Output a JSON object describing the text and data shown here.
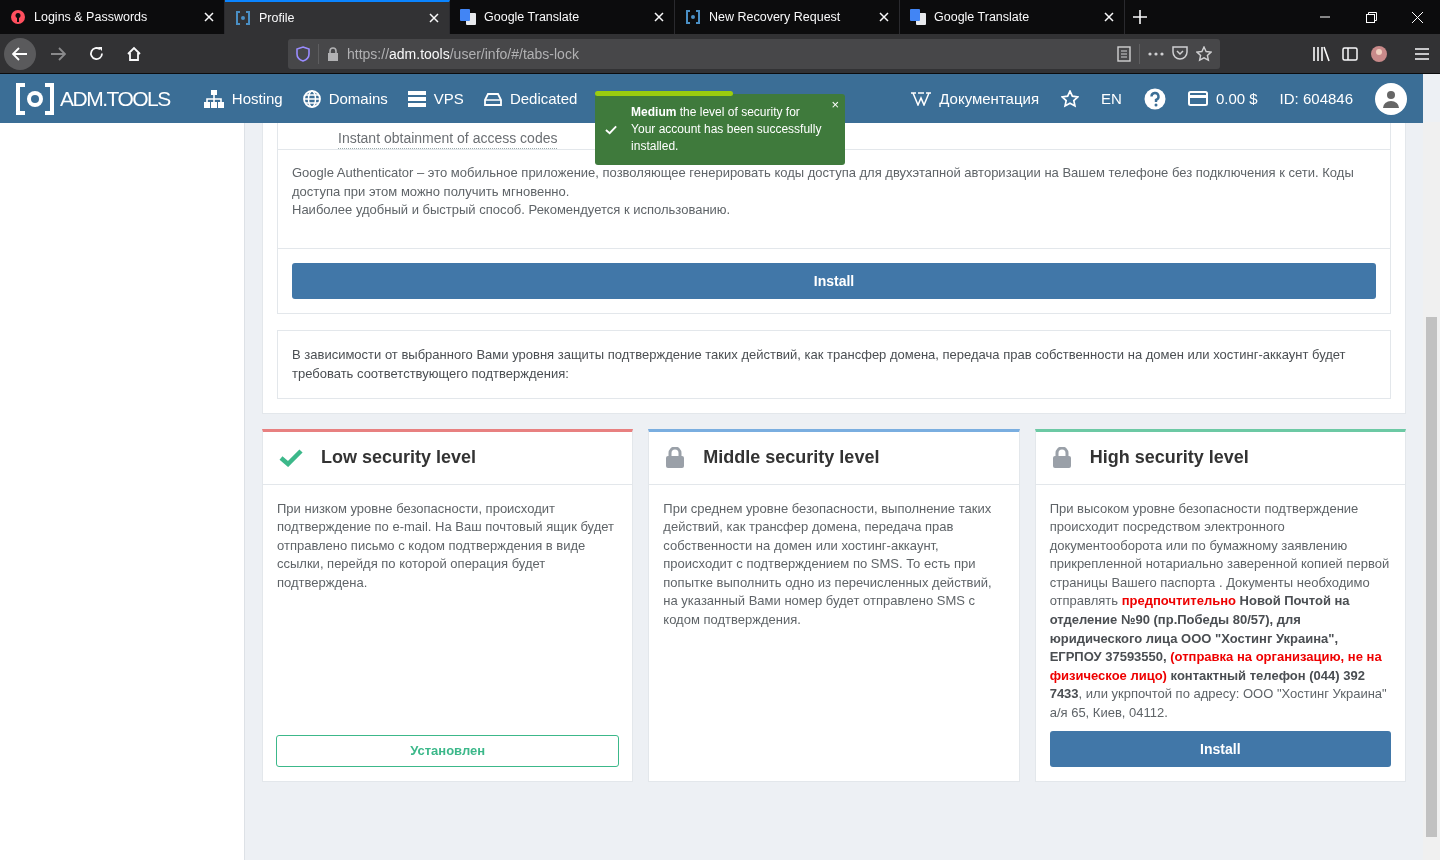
{
  "browser": {
    "tabs": [
      {
        "title": "Logins & Passwords",
        "selected": false
      },
      {
        "title": "Profile",
        "selected": true
      },
      {
        "title": "Google Translate",
        "selected": false
      },
      {
        "title": "New Recovery Request",
        "selected": false
      },
      {
        "title": "Google Translate",
        "selected": false
      }
    ],
    "url": {
      "scheme": "https://",
      "host": "adm.tools",
      "path": "/user/info/#/tabs-lock"
    }
  },
  "header": {
    "logo": "ADM.TOOLS",
    "nav": [
      {
        "label": "Hosting"
      },
      {
        "label": "Domains"
      },
      {
        "label": "VPS"
      },
      {
        "label": "Dedicated"
      }
    ],
    "docs": "Документация",
    "lang": "EN",
    "balance": "0.00 $",
    "id": "ID: 604846"
  },
  "toast": {
    "text": "**Medium** the level of security for Your account has been successfully installed.",
    "close": "×",
    "level": 0.55
  },
  "method": {
    "link": "Instant obtainment of access codes",
    "description": [
      "Google Authenticator – это мобильное приложение, позволяющее генерировать коды доступа для двухэтапной авторизации на Вашем телефоне без подключения к сети. Коды доступа при этом можно получить мгновенно.",
      "Наиболее удобный и быстрый способ. Рекомендуется к использованию."
    ],
    "button": "Install"
  },
  "notice": "В зависимости от выбранного Вами уровня защиты подтверждение таких действий, как трансфер домена, передача прав собственности на домен или хостинг-аккаунт будет требовать соответствующего подтверждения:",
  "levels": [
    {
      "title": "Low security level",
      "color": "#e88080",
      "installed": true,
      "text": "При низком уровне безопасности, происходит подтверждение по e-mail. На Ваш почтовый ящик будет отправлено письмо с кодом подтверждения в виде ссылки, перейдя по которой операция будет подтверждена.",
      "button": "Установлен"
    },
    {
      "title": "Middle security level",
      "color": "#7aaee0",
      "installed": false,
      "text": "При среднем уровне безопасности, выполнение таких действий, как трансфер домена, передача прав собственности на домен или хостинг-аккаунт, происходит с подтверждением по SMS. То есть при попытке выполнить одно из перечисленных действий, на указанный Вами номер будет отправлено SMS с кодом подтверждения."
    },
    {
      "title": "High security level",
      "color": "#6cc9a4",
      "installed": false,
      "parts": [
        {
          "kind": "plain",
          "text": "При высоком уровне безопасности подтверждение происходит посредством электронного документооборота или по бумажному заявлению прикрепленной нотариально заверенной копией первой страницы Вашего паспорта . Документы необходимо отправлять "
        },
        {
          "kind": "alert",
          "text": "предпочтительно"
        },
        {
          "kind": "strong",
          "text": " Новой Почтой на отделение №90 (пр.Победы 80/57), для юридического лица ООО \"Хостинг Украина\", ЕГРПОУ 37593550, "
        },
        {
          "kind": "alert",
          "text": "(отправка на организацию, не на физическое лицо)"
        },
        {
          "kind": "strong",
          "text": " контактный телефон (044) 392 7433"
        },
        {
          "kind": "plain",
          "text": ", или укрпочтой по адресу: ООО \"Хостинг Украина\" а/я 65, Киев, 04112."
        }
      ],
      "button": "Install"
    }
  ]
}
